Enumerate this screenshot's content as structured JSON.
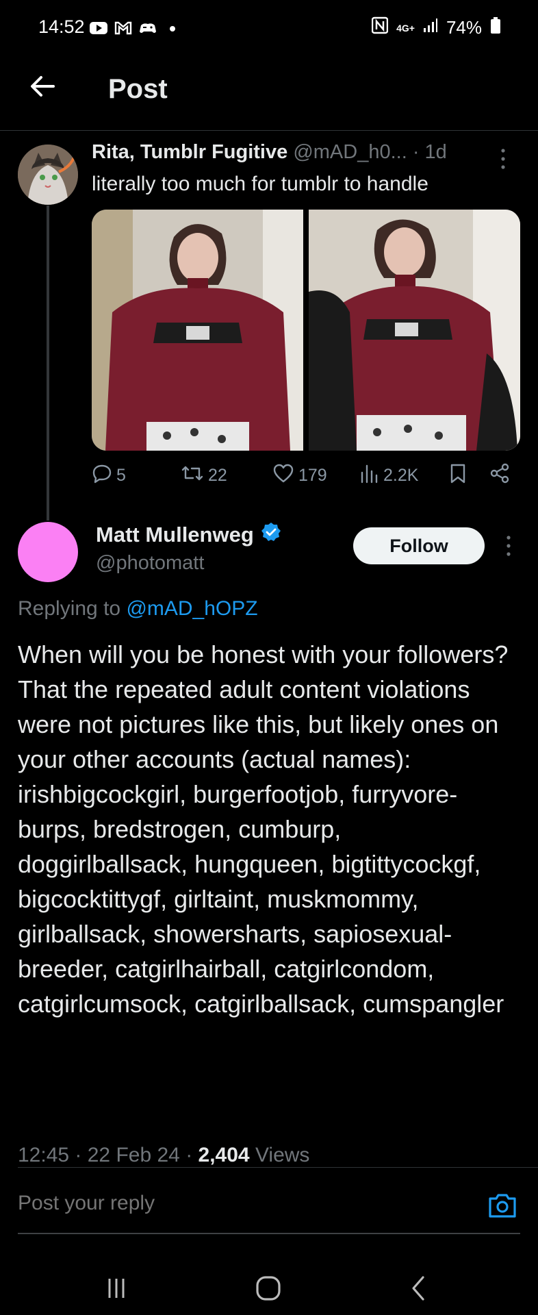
{
  "status_bar": {
    "time": "14:52",
    "battery": "74%",
    "network": "4G+",
    "left_icons": [
      "youtube-icon",
      "gmail-icon",
      "game-icon",
      "dot-icon"
    ],
    "right_icons": [
      "nfc-icon",
      "network-icon",
      "signal-icon",
      "battery-icon"
    ]
  },
  "header": {
    "title": "Post",
    "back_icon": "arrow-left-icon"
  },
  "original_post": {
    "author_name": "Rita, Tumblr Fugitive",
    "handle": "@mAD_h0...",
    "separator": " · ",
    "time_ago": "1d",
    "text": "literally too much for tumblr to handle",
    "actions": {
      "replies": "5",
      "reposts": "22",
      "likes": "179",
      "views": "2.2K"
    },
    "colors": {
      "background": "#000000",
      "muted": "#71767b"
    }
  },
  "reply_post": {
    "author_name": "Matt Mullenweg",
    "handle": "@photomatt",
    "follow_label": "Follow",
    "replying_prefix": "Replying to ",
    "replying_handle": "@mAD_hOPZ",
    "text": "When will you be honest with your followers? That the repeated adult content violations were not pictures like this, but likely ones on your other accounts (actual names): irishbigcockgirl, burgerfootjob, furryvore-burps, bredstrogen, cumburp, doggirlballsack, hungqueen, bigtittycockgf, bigcocktittygf, girltaint, muskmommy, girlballsack, showersharts, sapiosexual-breeder, catgirlhairball, catgirlcondom, catgirlcumsock, catgirlballsack, cumspangler",
    "time": "12:45",
    "date": "22 Feb 24",
    "views_count": "2,404",
    "views_label": "Views",
    "avatar_color": "#fb80f4",
    "verified_color": "#1d9bf0"
  },
  "reply_box": {
    "placeholder": "Post your reply"
  },
  "accent_color": "#1d9bf0"
}
